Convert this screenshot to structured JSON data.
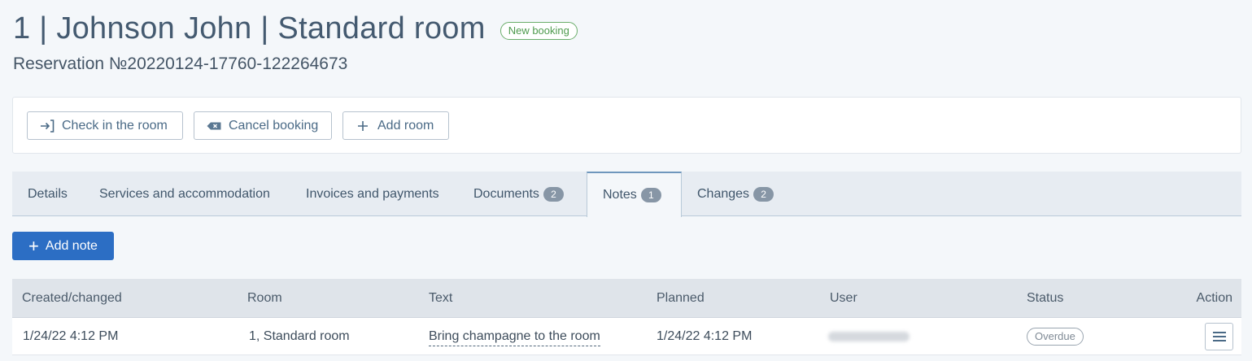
{
  "header": {
    "title": "1 | Johnson John | Standard room",
    "status_badge": "New booking",
    "reservation": "Reservation №20220124-17760-122264673"
  },
  "actions": {
    "check_in": "Check in the room",
    "cancel": "Cancel booking",
    "add_room": "Add room"
  },
  "tabs": [
    {
      "label": "Details",
      "count": null
    },
    {
      "label": "Services and accommodation",
      "count": null
    },
    {
      "label": "Invoices and payments",
      "count": null
    },
    {
      "label": "Documents",
      "count": "2"
    },
    {
      "label": "Notes",
      "count": "1"
    },
    {
      "label": "Changes",
      "count": "2"
    }
  ],
  "active_tab": "Notes",
  "add_note_label": "Add note",
  "table": {
    "columns": [
      "Created/changed",
      "Room",
      "Text",
      "Planned",
      "User",
      "Status",
      "Action"
    ],
    "rows": [
      {
        "created": "1/24/22 4:12 PM",
        "room": "1, Standard room",
        "text": "Bring champagne to the room",
        "planned": "1/24/22 4:12 PM",
        "status": "Overdue"
      }
    ]
  },
  "icons": {
    "check_in": "login-arrow-icon",
    "cancel": "backspace-icon",
    "add_room": "plus-icon",
    "add_note": "plus-icon",
    "row_action": "menu-icon"
  },
  "colors": {
    "primary": "#2c6ec4",
    "new_booking": "#4e9a4e",
    "overdue": "#7f8a95"
  }
}
